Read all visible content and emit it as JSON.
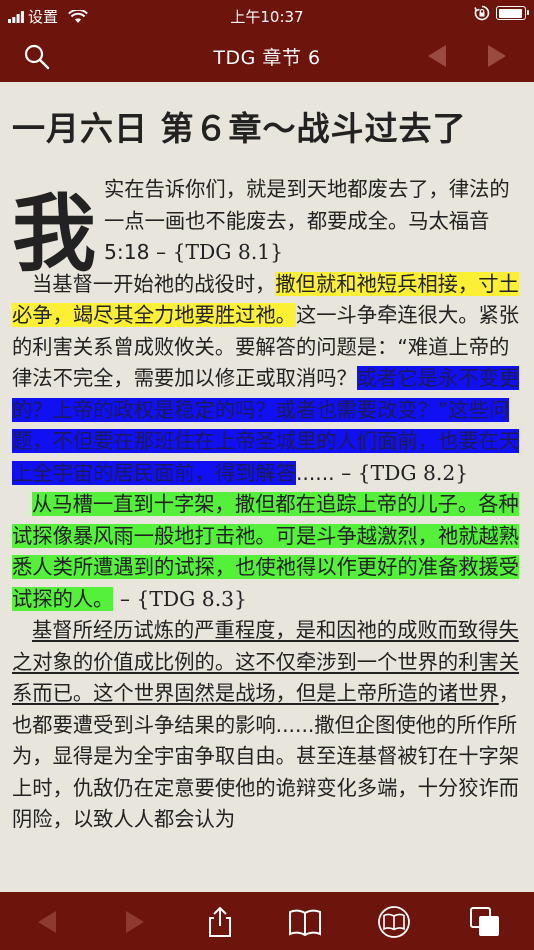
{
  "status_bar": {
    "carrier": "设置",
    "time": "上午10:37",
    "battery_level": 0.95
  },
  "nav": {
    "title": "TDG 章节 6"
  },
  "content": {
    "chapter_title": "一月六日 第６章～战斗过去了",
    "drop_cap": "我",
    "p1_rest": "实在告诉你们，就是到天地都废去了，律法的一点一画也不能废去，都要成全。马太福音5:18 – ",
    "p1_ref": "{TDG 8.1}",
    "p2_a": "当基督一开始祂的战役时，",
    "p2_hl_yellow": "撒但就和祂短兵相接，寸土必争，竭尽其全力地要胜过祂。",
    "p2_b": "这一斗争牵连很大。紧张的利害关系曾成败攸关。要解答的问题是：“难道上帝的律法不完全，需要加以修正或取消吗？",
    "p2_hl_blue": "或者它是永不变更的？上帝的政权是稳定的吗？或者也需要改变？”这些问题，不但要在那班住在上帝圣城里的人们面前，也要在天上全宇宙的居民面前，得到解答",
    "p2_c": "...... – ",
    "p2_ref": "{TDG 8.2}",
    "p3_hl_green": "从马槽一直到十字架，撒但都在追踪上帝的儿子。各种试探像暴风雨一般地打击祂。可是斗争越激烈，祂就越熟悉人类所遭遇到的试探，也使祂得以作更好的准备救援受试探的人。",
    "p3_c": " – ",
    "p3_ref": "{TDG 8.3}",
    "p4_ul": "基督所经历试炼的严重程度，是和因祂的成败而致得失之对象的价值成比例的。这不仅牵涉到一个世界的利害关系而已。这个世界固然是战场，但是上帝所造的诸世界",
    "p4_b": "，也都要遭受到斗争结果的影响......撒但企图使他的所作所为，显得是为全宇宙争取自由。甚至连基督被钉在十字架上时，仇敌仍在定意要使他的诡辩变化多端，十分狡诈而阴险，以致人人都会认为"
  }
}
